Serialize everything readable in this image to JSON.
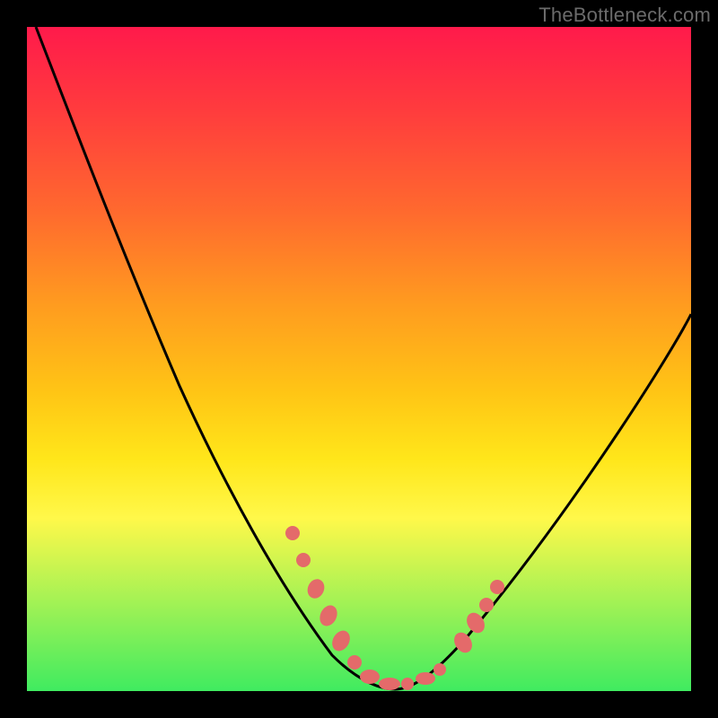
{
  "watermark": "TheBottleneck.com",
  "chart_data": {
    "type": "line",
    "title": "",
    "xlabel": "",
    "ylabel": "",
    "xlim": [
      0,
      100
    ],
    "ylim": [
      0,
      100
    ],
    "grid": false,
    "legend": false,
    "series": [
      {
        "name": "left-curve",
        "x": [
          0,
          6,
          12,
          18,
          24,
          30,
          36,
          40,
          44,
          48,
          52,
          55
        ],
        "values": [
          100,
          90,
          78,
          66,
          54,
          42,
          30,
          22,
          14,
          6,
          2,
          0
        ]
      },
      {
        "name": "right-curve",
        "x": [
          55,
          58,
          62,
          67,
          72,
          78,
          84,
          90,
          96,
          100
        ],
        "values": [
          0,
          2,
          5,
          10,
          16,
          24,
          33,
          42,
          50,
          56
        ]
      },
      {
        "name": "dotted-band-left",
        "x": [
          40,
          42,
          44,
          46,
          48,
          50,
          52
        ],
        "values": [
          22,
          18,
          14,
          10,
          6,
          3,
          1
        ]
      },
      {
        "name": "dotted-band-right",
        "x": [
          60,
          62,
          64,
          66
        ],
        "values": [
          4,
          7,
          11,
          16
        ]
      },
      {
        "name": "dotted-band-bottom",
        "x": [
          48,
          50,
          52,
          55,
          58,
          61,
          63
        ],
        "values": [
          2,
          1,
          0,
          0,
          1,
          2,
          4
        ]
      }
    ],
    "background_gradient": {
      "top": "#ff1a4b",
      "upper_mid": "#ff9c1f",
      "lower_mid": "#fff84a",
      "bottom": "#40eb60"
    }
  }
}
